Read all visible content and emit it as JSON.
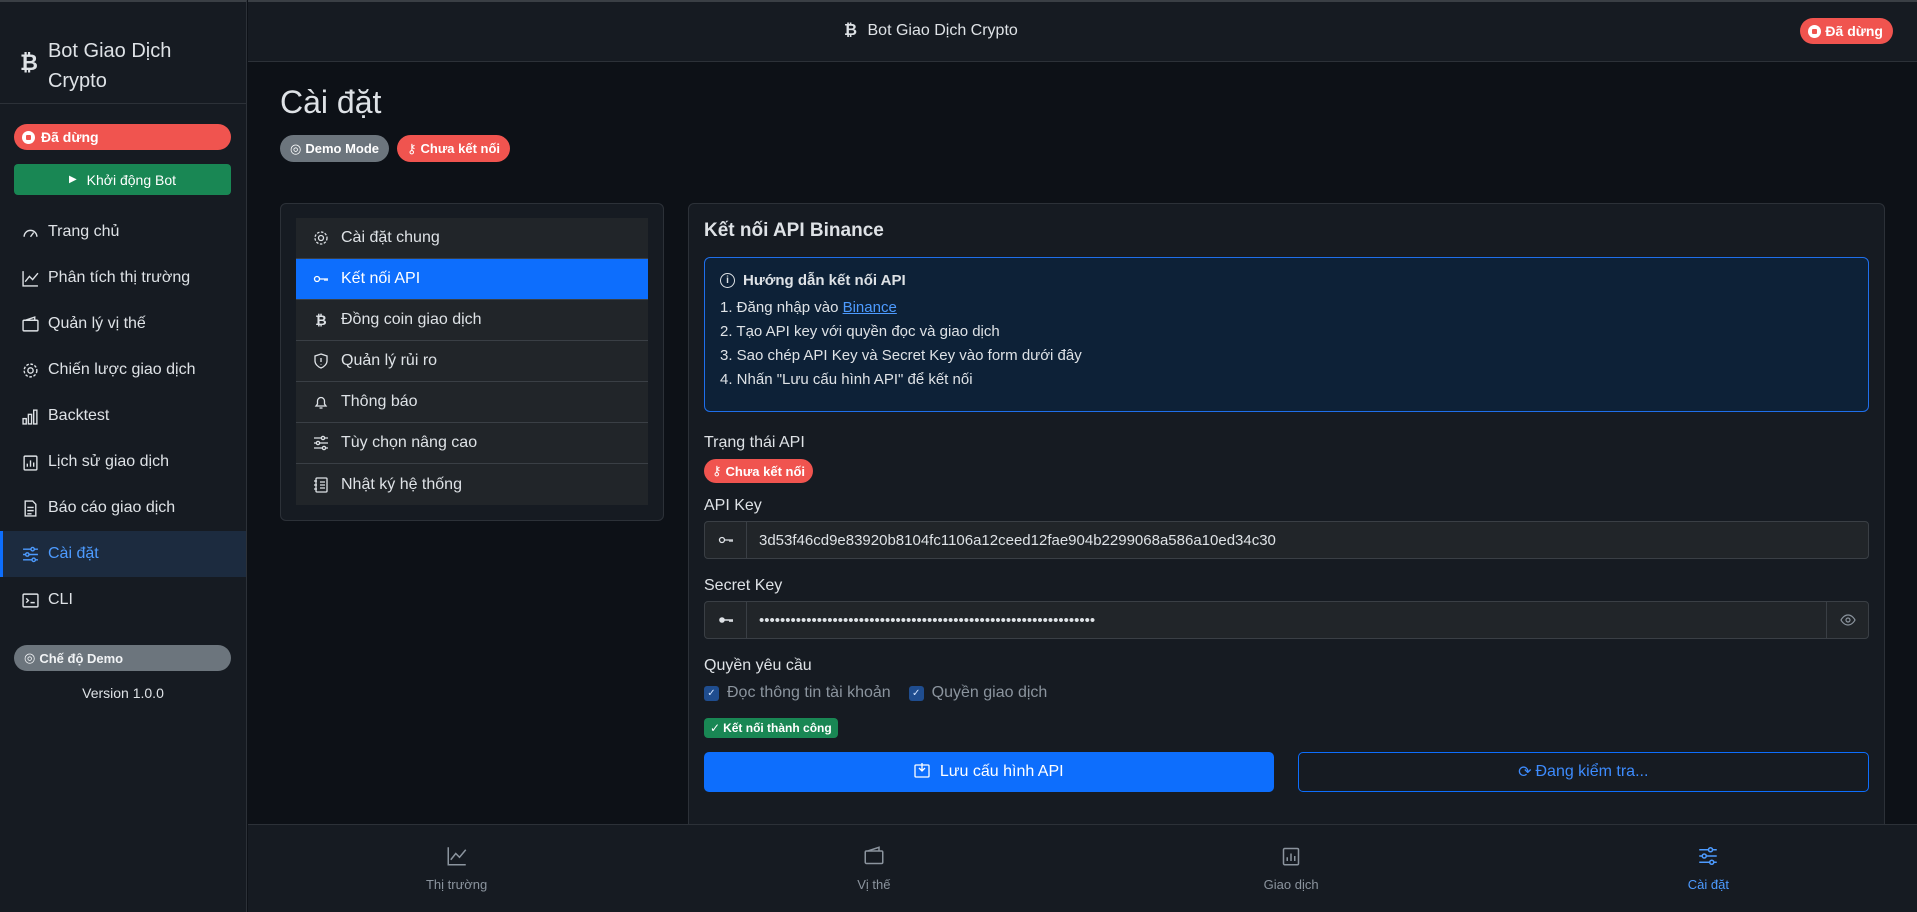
{
  "sidebar": {
    "brand_icon": "₿",
    "brand_title": "Bot Giao Dịch Crypto",
    "status": "Đã dừng",
    "start_button": "Khởi động Bot",
    "items": [
      {
        "label": "Trang chủ",
        "icon": "speedometer-icon"
      },
      {
        "label": "Phân tích thị trường",
        "icon": "chart-line-icon"
      },
      {
        "label": "Quản lý vị thế",
        "icon": "wallet-icon"
      },
      {
        "label": "Chiến lược giao dịch",
        "icon": "gear-icon"
      },
      {
        "label": "Backtest",
        "icon": "bar-chart-icon"
      },
      {
        "label": "Lịch sử giao dịch",
        "icon": "clipboard-data-icon"
      },
      {
        "label": "Báo cáo giao dịch",
        "icon": "file-text-icon"
      },
      {
        "label": "Cài đặt",
        "icon": "sliders-icon",
        "active": true
      },
      {
        "label": "CLI",
        "icon": "terminal-icon"
      }
    ],
    "demo_mode": "Chế độ Demo",
    "version": "Version 1.0.0"
  },
  "topbar": {
    "title_icon": "₿",
    "title": "Bot Giao Dịch Crypto",
    "status": "Đã dừng"
  },
  "page": {
    "title": "Cài đặt",
    "badge_demo": "Demo Mode",
    "badge_connection": "Chưa kết nối"
  },
  "settings_menu": [
    {
      "label": "Cài đặt chung",
      "icon": "gear-icon"
    },
    {
      "label": "Kết nối API",
      "icon": "key-icon",
      "active": true
    },
    {
      "label": "Đồng coin giao dịch",
      "icon": "bitcoin-icon"
    },
    {
      "label": "Quản lý rủi ro",
      "icon": "shield-icon"
    },
    {
      "label": "Thông báo",
      "icon": "bell-icon"
    },
    {
      "label": "Tùy chọn nâng cao",
      "icon": "sliders-icon"
    },
    {
      "label": "Nhật ký hệ thống",
      "icon": "journal-icon"
    }
  ],
  "api_card": {
    "title": "Kết nối API Binance",
    "guide_title": "Hướng dẫn kết nối API",
    "guide_step1_prefix": "1. Đăng nhập vào ",
    "guide_step1_link": "Binance",
    "guide_step2": "2. Tạo API key với quyền đọc và giao dịch",
    "guide_step3": "3. Sao chép API Key và Secret Key vào form dưới đây",
    "guide_step4": "4. Nhấn \"Lưu cấu hình API\" để kết nối",
    "status_label": "Trạng thái API",
    "status_badge": "Chưa kết nối",
    "api_key_label": "API Key",
    "api_key_value": "3d53f46cd9e83920b8104fc1106a12ceed12fae904b2299068a586a10ed34c30",
    "secret_key_label": "Secret Key",
    "secret_key_value": "••••••••••••••••••••••••••••••••••••••••••••••••••••••••••••••••",
    "permissions_label": "Quyền yêu cầu",
    "perm_read": "Đọc thông tin tài khoản",
    "perm_trade": "Quyền giao dịch",
    "success_badge": "Kết nối thành công",
    "save_button": "Lưu cấu hình API",
    "check_button": "Đang kiểm tra..."
  },
  "bottom_nav": [
    {
      "label": "Thị trường",
      "icon": "chart-line-icon"
    },
    {
      "label": "Vị thế",
      "icon": "wallet-icon"
    },
    {
      "label": "Giao dịch",
      "icon": "clipboard-data-icon"
    },
    {
      "label": "Cài đặt",
      "icon": "sliders-icon",
      "active": true
    }
  ],
  "colors": {
    "accent": "#0d6efd",
    "danger": "#f0544f",
    "success": "#198754",
    "background": "#0d1117"
  }
}
